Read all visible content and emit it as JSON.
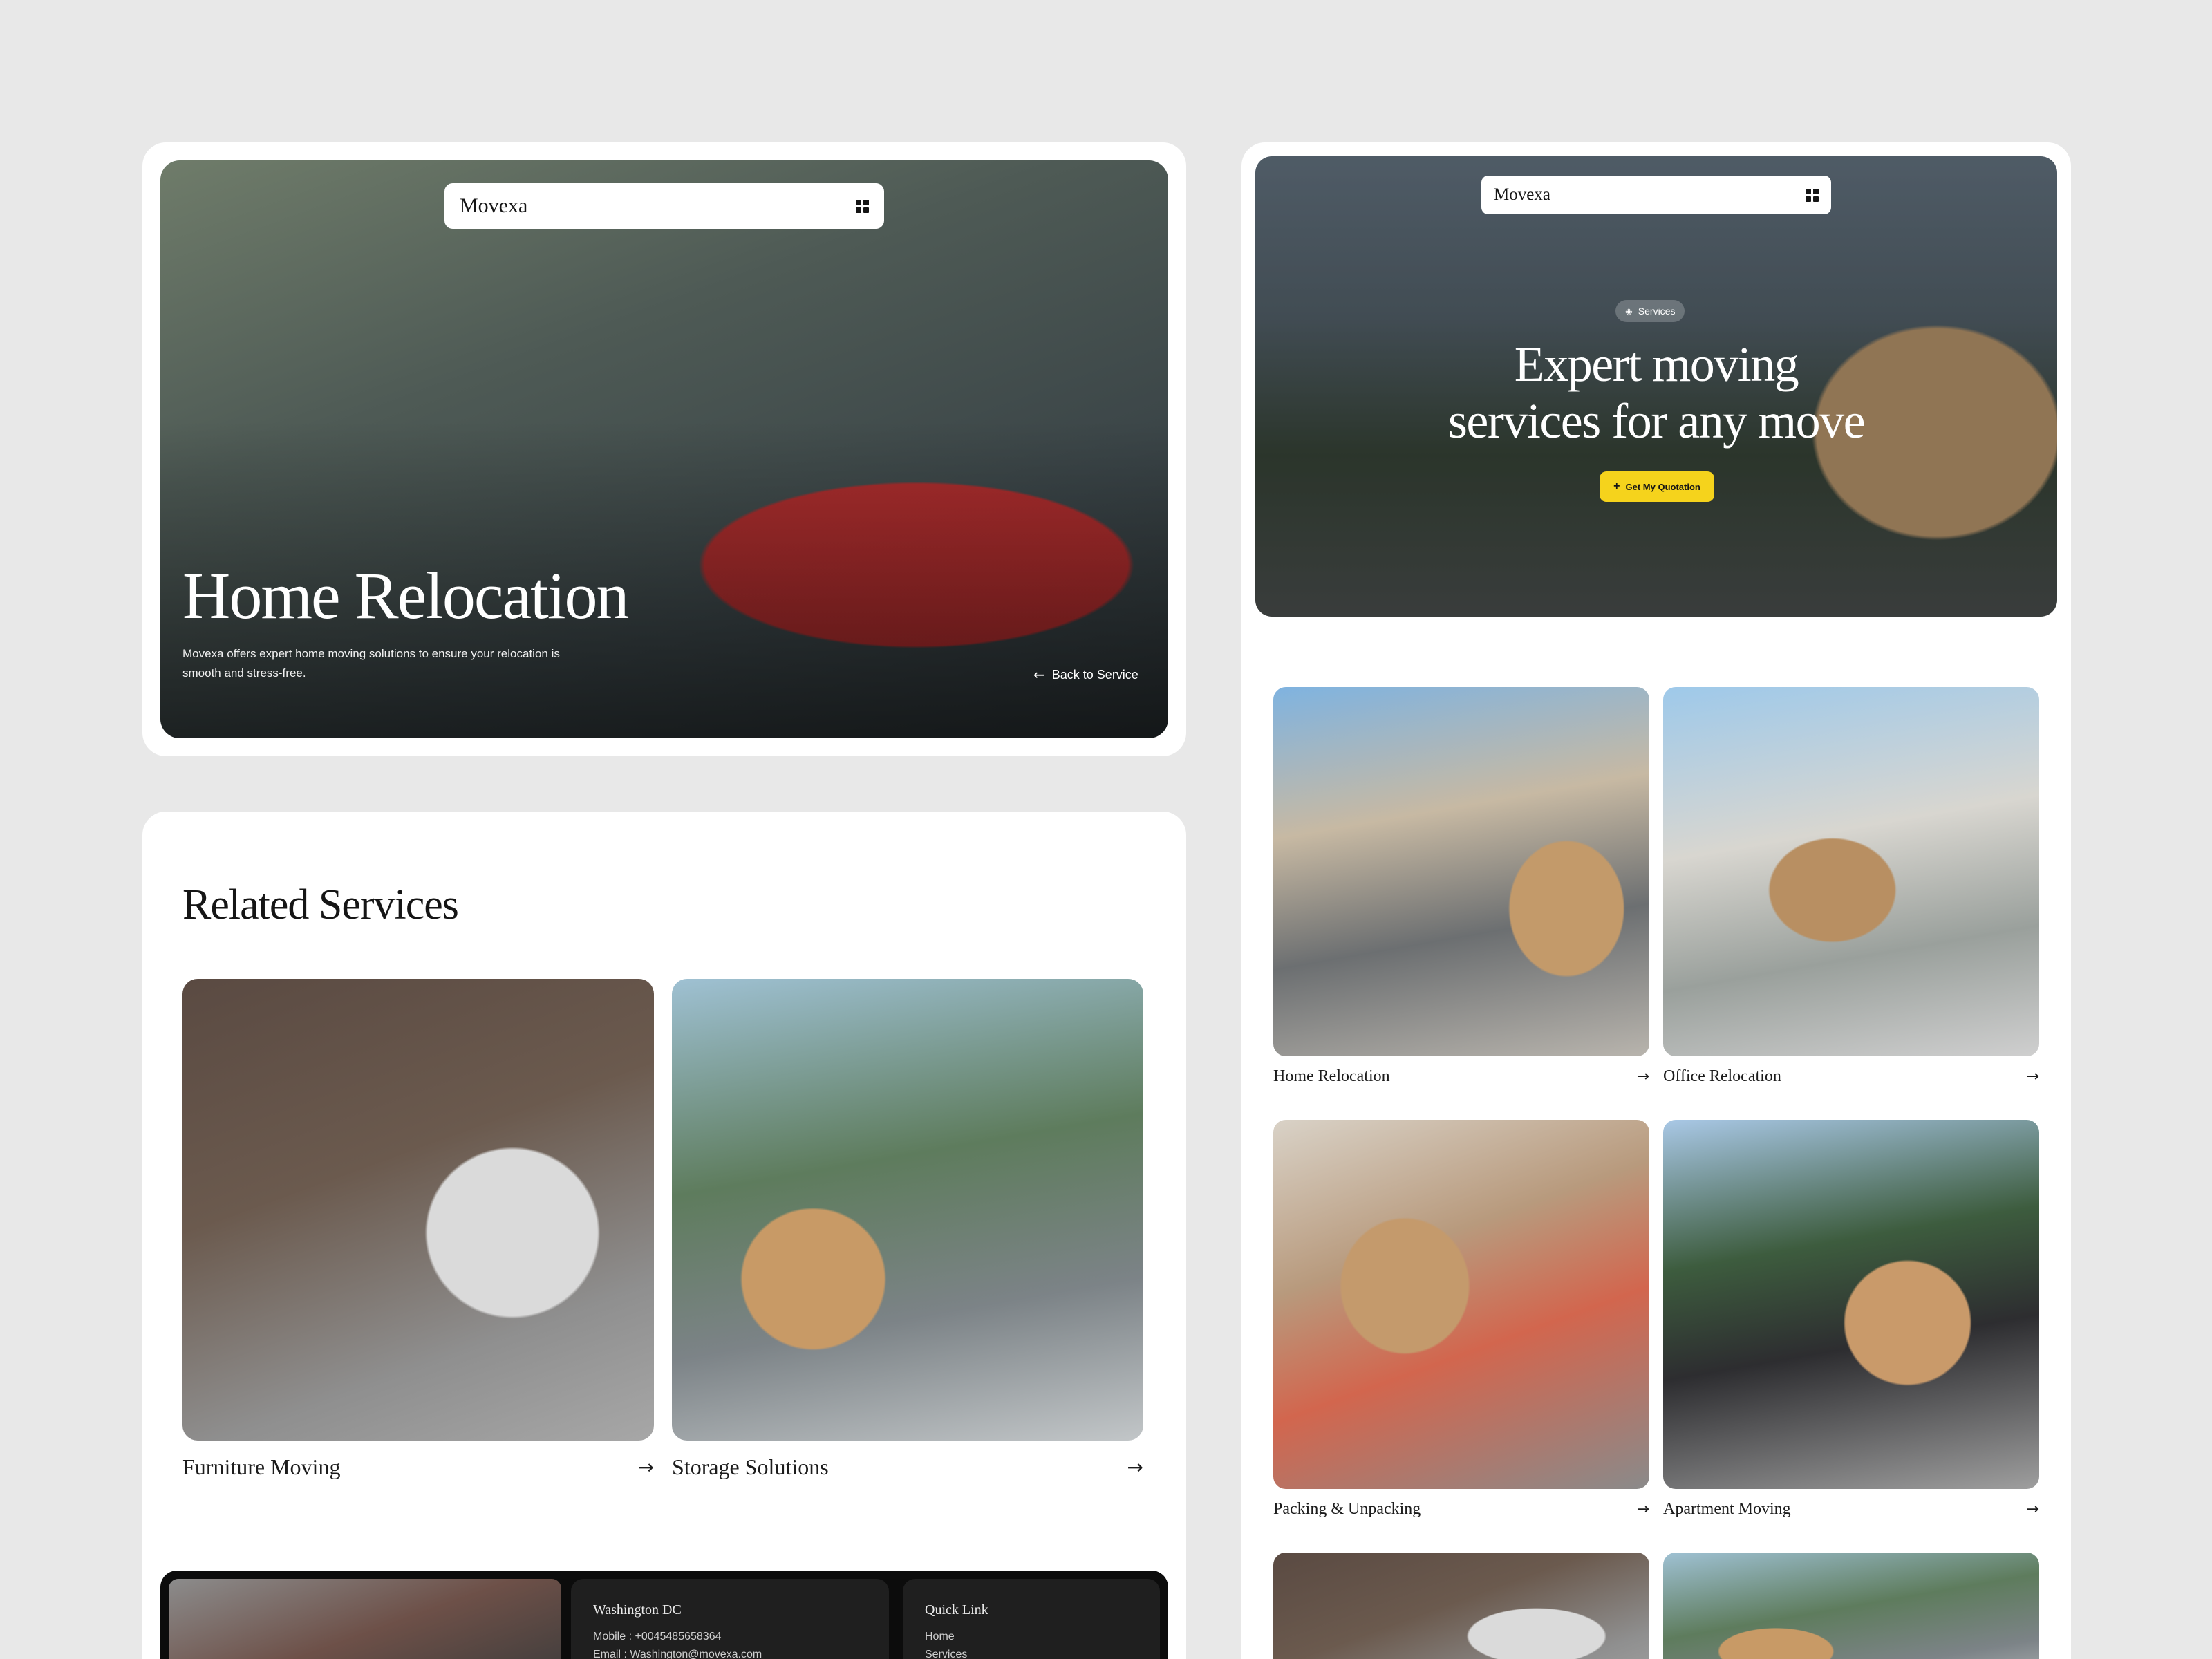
{
  "brand": "Movexa",
  "detail": {
    "title": "Home Relocation",
    "description_line1": "Movexa offers expert home moving solutions to ensure your relocation is",
    "description_line2": "smooth and stress-free.",
    "back_label": "Back to Service"
  },
  "services_hero": {
    "badge": "Services",
    "title_line1": "Expert moving",
    "title_line2": "services for any move",
    "cta_label": "Get My Quotation"
  },
  "related": {
    "title": "Related Services",
    "cards": [
      {
        "label": "Furniture Moving"
      },
      {
        "label": "Storage Solutions"
      }
    ]
  },
  "services_grid": [
    {
      "label": "Home Relocation"
    },
    {
      "label": "Office Relocation"
    },
    {
      "label": "Packing & Unpacking"
    },
    {
      "label": "Apartment Moving"
    }
  ],
  "footer": {
    "contact_title": "Washington DC",
    "contact_mobile": "Mobile : +0045485658364",
    "contact_email": "Email : Washington@movexa.com",
    "quick_title": "Quick Link",
    "quick_links": [
      "Home",
      "Services"
    ]
  },
  "colors": {
    "page_bg": "#e8e8e8",
    "accent": "#f5d31c",
    "footer_bg": "#0c0c0c"
  }
}
